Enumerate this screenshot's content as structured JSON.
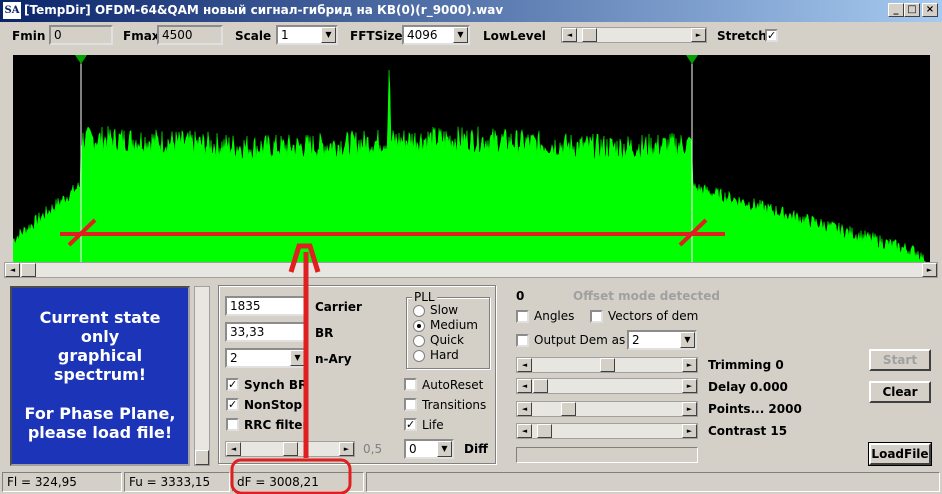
{
  "window": {
    "title": "[TempDir] OFDM-64&QAM новый сигнал-гибрид на КВ(0)(r_9000).wav",
    "app_icon": "SA",
    "minimize": "_",
    "maximize": "□",
    "close": "×"
  },
  "toolbar": {
    "fmin_label": "Fmin",
    "fmin_value": "0",
    "fmax_label": "Fmax",
    "fmax_value": "4500",
    "scale_label": "Scale",
    "scale_value": "1",
    "fftsize_label": "FFTSize",
    "fftsize_value": "4096",
    "lowlevel_label": "LowLevel",
    "lowlevel_level": 0.05,
    "stretch_label": "Stretch",
    "stretch_checked": true
  },
  "spectrum": {
    "colors": {
      "background": "#000000",
      "signal": "#00ff00",
      "marker": "#00a000",
      "annotation": "#e02020"
    }
  },
  "overlay_message": {
    "line1": "Current state",
    "line2": "only",
    "line3": "graphical spectrum!",
    "line4": "For Phase Plane,",
    "line5": "please load file!"
  },
  "demod": {
    "carrier_value": "1835",
    "carrier_label": "Carrier",
    "br_value": "33,33",
    "br_label": "BR",
    "nary_value": "2",
    "nary_label": "n-Ary",
    "synch_br_label": "Synch BR",
    "synch_br_checked": true,
    "nonstop_label": "NonStop",
    "nonstop_checked": true,
    "rrc_label": "RRC filter",
    "rrc_checked": false,
    "slider_value": "0,5",
    "pll": {
      "title": "PLL",
      "options": [
        "Slow",
        "Medium",
        "Quick",
        "Hard"
      ],
      "selected": "Medium"
    },
    "autoreset_label": "AutoReset",
    "autoreset_checked": false,
    "transitions_label": "Transitions",
    "transitions_checked": false,
    "life_label": "Life",
    "life_checked": true,
    "diff_value": "0",
    "diff_label": "Diff"
  },
  "right_panel": {
    "counter": "0",
    "offset_status": "Offset mode detected",
    "angles_label": "Angles",
    "angles_checked": false,
    "vectors_label": "Vectors of dem",
    "vectors_checked": false,
    "output_dem_label": "Output Dem as",
    "output_dem_checked": false,
    "output_dem_value": "2",
    "trimming_label": "Trimming 0",
    "delay_label": "Delay  0.000",
    "points_label": "Points... 2000",
    "contrast_label": "Contrast 15",
    "start_label": "Start",
    "clear_label": "Clear",
    "loadfile_label": "LoadFile"
  },
  "statusbar": {
    "fl": "Fl = 324,95",
    "fu": "Fu = 3333,15",
    "df": "dF = 3008,21"
  },
  "icons": {
    "check": "✓",
    "arrow_left": "◄",
    "arrow_right": "►",
    "arrow_down": "▼"
  }
}
